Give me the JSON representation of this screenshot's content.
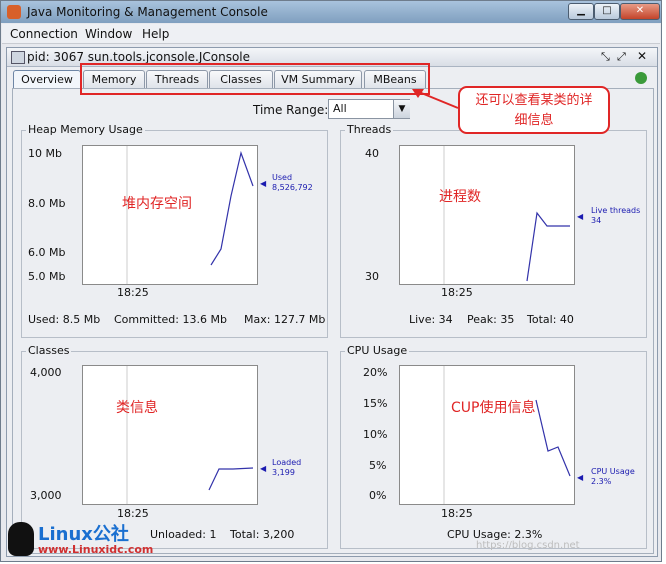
{
  "window": {
    "title": "Java Monitoring & Management Console",
    "controls": {
      "minimize": "▁",
      "maximize": "□",
      "close": "✕"
    }
  },
  "menu": [
    "Connection",
    "Window",
    "Help"
  ],
  "frame": {
    "title": "pid: 3067 sun.tools.jconsole.JConsole"
  },
  "tabs": [
    "Overview",
    "Memory",
    "Threads",
    "Classes",
    "VM Summary",
    "MBeans"
  ],
  "time_range": {
    "label": "Time Range:",
    "value": "All"
  },
  "annotation": {
    "text_line1": "还可以查看某类的详",
    "text_line2": "细信息"
  },
  "panels": {
    "heap": {
      "title": "Heap Memory Usage",
      "y_ticks": [
        "10 Mb",
        "8.0 Mb",
        "6.0 Mb",
        "5.0 Mb"
      ],
      "x_tick": "18:25",
      "series_label": "Used",
      "series_value": "8,526,792",
      "overlay": "堆内存空间",
      "info": {
        "used": "Used: 8.5 Mb",
        "committed": "Committed: 13.6 Mb",
        "max": "Max: 127.7 Mb"
      }
    },
    "threads": {
      "title": "Threads",
      "y_ticks": [
        "40",
        "30"
      ],
      "x_tick": "18:25",
      "series_label": "Live threads",
      "series_value": "34",
      "overlay": "进程数",
      "info": {
        "live": "Live: 34",
        "peak": "Peak: 35",
        "total": "Total: 40"
      }
    },
    "classes": {
      "title": "Classes",
      "y_ticks": [
        "4,000",
        "3,000"
      ],
      "x_tick": "18:25",
      "series_label": "Loaded",
      "series_value": "3,199",
      "overlay": "类信息",
      "info": {
        "unloaded": "Unloaded: 1",
        "total": "Total: 3,200"
      }
    },
    "cpu": {
      "title": "CPU Usage",
      "y_ticks": [
        "20%",
        "15%",
        "10%",
        "5%",
        "0%"
      ],
      "x_tick": "18:25",
      "series_label": "CPU Usage",
      "series_value": "2.3%",
      "overlay": "CUP使用信息",
      "info": {
        "usage": "CPU Usage: 2.3%"
      }
    }
  },
  "watermark": {
    "logo": "Linux公社",
    "url": "www.Linuxidc.com",
    "blog": "https://blog.csdn.net"
  },
  "colors": {
    "line": "#3333aa",
    "annotation": "#e02626"
  }
}
